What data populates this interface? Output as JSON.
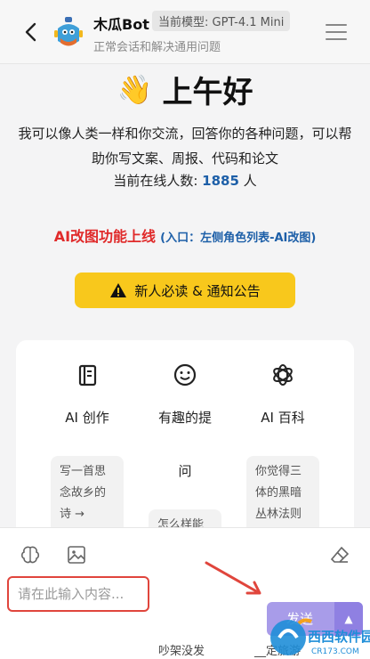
{
  "header": {
    "bot_name": "木瓜Bot",
    "model_badge": "当前模型: GPT-4.1 Mini",
    "subtitle": "正常会话和解决通用问题"
  },
  "greeting": {
    "emoji": "👋",
    "text": "上午好"
  },
  "intro": "我可以像人类一样和你交流，回答你的各种问题，可以帮助你写文案、周报、代码和论文",
  "online": {
    "prefix": "当前在线人数: ",
    "count": "1885",
    "suffix": " 人"
  },
  "promo": {
    "title": "AI改图功能上线",
    "hint": "(入口：左侧角色列表-AI改图)"
  },
  "notice_button": "新人必读 & 通知公告",
  "features": [
    {
      "icon": "notebook-icon",
      "label": "AI 创作",
      "prompt_lines": [
        "写一首思",
        "念故乡的",
        "诗 →"
      ]
    },
    {
      "icon": "smile-icon",
      "label_lines": [
        "有趣的提",
        "问"
      ],
      "prompt_lines": [
        "怎么样能"
      ]
    },
    {
      "icon": "openai-icon",
      "label": "AI 百科",
      "prompt_lines": [
        "你觉得三",
        "体的黑暗",
        "丛林法则"
      ]
    }
  ],
  "input": {
    "placeholder": "请在此输入内容...",
    "send_label": "发送"
  },
  "behind_text": {
    "left": "吵架没发",
    "right": "__定旅游"
  },
  "watermark": {
    "brand": "西西软件园",
    "domain": "CR173.COM"
  },
  "colors": {
    "accent_purple": "#a89ce9",
    "notice_yellow": "#f8c81c",
    "promo_red": "#e02a2a",
    "link_blue": "#1d5fa8",
    "highlight_red": "#e0453c"
  }
}
